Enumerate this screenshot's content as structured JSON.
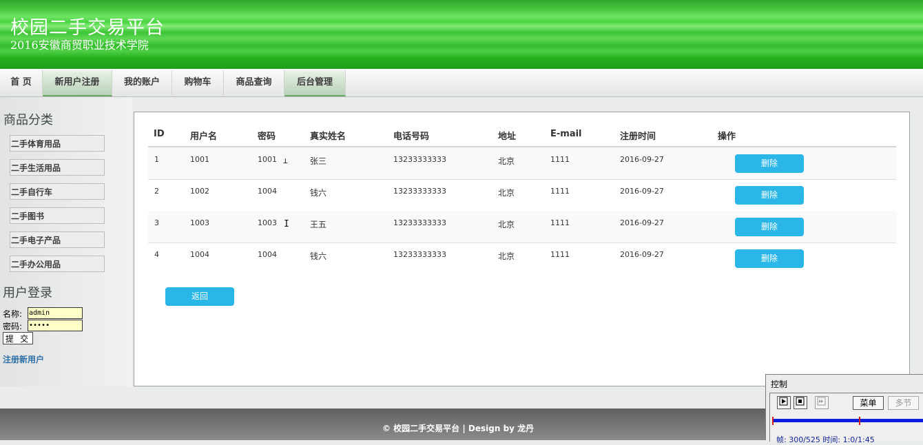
{
  "header": {
    "title": "校园二手交易平台",
    "subtitle": "2016安徽商贸职业技术学院"
  },
  "nav": {
    "items": [
      "首 页",
      "新用户注册",
      "我的账户",
      "购物车",
      "商品查询",
      "后台管理"
    ],
    "active": [
      "新用户注册",
      "后台管理"
    ]
  },
  "sidebar": {
    "category_heading": "商品分类",
    "categories": [
      "二手体育用品",
      "二手生活用品",
      "二手自行车",
      "二手图书",
      "二手电子产品",
      "二手办公用品"
    ],
    "login_heading": "用户登录",
    "name_label": "名称:",
    "name_value": "admin",
    "password_label": "密码:",
    "password_value": "•••••",
    "submit_label": "提 交",
    "register_link": "注册新用户"
  },
  "table": {
    "headers": [
      "ID",
      "用户名",
      "密码",
      "真实姓名",
      "电话号码",
      "地址",
      "E-mail",
      "注册时间",
      "操作"
    ],
    "rows": [
      {
        "id": "1",
        "username": "1001",
        "password": "1001",
        "realname": "张三",
        "phone": "13233333333",
        "address": "北京",
        "email": "1111",
        "date": "2016-09-27",
        "action": "删除"
      },
      {
        "id": "2",
        "username": "1002",
        "password": "1004",
        "realname": "钱六",
        "phone": "13233333333",
        "address": "北京",
        "email": "1111",
        "date": "2016-09-27",
        "action": "删除"
      },
      {
        "id": "3",
        "username": "1003",
        "password": "1003",
        "realname": "王五",
        "phone": "13233333333",
        "address": "北京",
        "email": "1111",
        "date": "2016-09-27",
        "action": "删除"
      },
      {
        "id": "4",
        "username": "1004",
        "password": "1004",
        "realname": "钱六",
        "phone": "13233333333",
        "address": "北京",
        "email": "1111",
        "date": "2016-09-27",
        "action": "删除"
      }
    ],
    "back_label": "返回"
  },
  "footer": {
    "text": "© 校园二手交易平台 | Design by 龙丹"
  },
  "control_window": {
    "title": "控制",
    "play_icon": "play-icon",
    "stop_icon": "stop-icon",
    "skip_icon": "skip-icon",
    "menu_label": "菜单",
    "multi_label": "多节",
    "frame_info": "帧: 300/525 时间: 1:0/1:45",
    "progress_fraction": 0.571
  },
  "colors": {
    "header_green": "#33bd2c",
    "button_blue": "#2ab7e8",
    "link_blue": "#2e6fa8",
    "input_yellow": "#ffffc8"
  }
}
